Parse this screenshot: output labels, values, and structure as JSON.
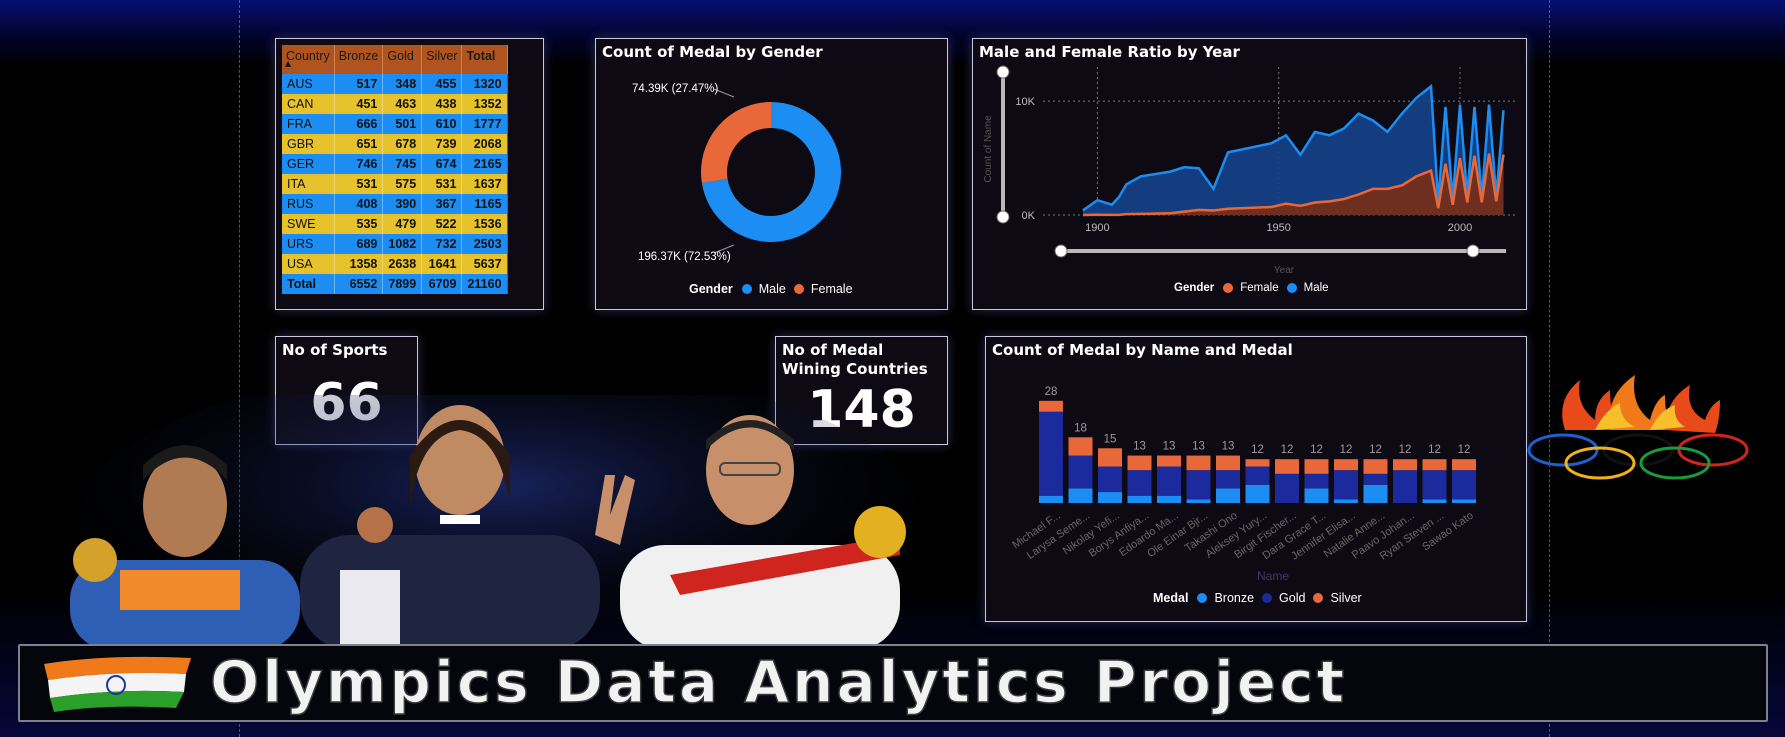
{
  "medal_table": {
    "headers": [
      "Country",
      "Bronze",
      "Gold",
      "Silver",
      "Total"
    ],
    "rows": [
      {
        "country": "AUS",
        "bronze": "517",
        "gold": "348",
        "silver": "455",
        "total": "1320"
      },
      {
        "country": "CAN",
        "bronze": "451",
        "gold": "463",
        "silver": "438",
        "total": "1352"
      },
      {
        "country": "FRA",
        "bronze": "666",
        "gold": "501",
        "silver": "610",
        "total": "1777"
      },
      {
        "country": "GBR",
        "bronze": "651",
        "gold": "678",
        "silver": "739",
        "total": "2068"
      },
      {
        "country": "GER",
        "bronze": "746",
        "gold": "745",
        "silver": "674",
        "total": "2165"
      },
      {
        "country": "ITA",
        "bronze": "531",
        "gold": "575",
        "silver": "531",
        "total": "1637"
      },
      {
        "country": "RUS",
        "bronze": "408",
        "gold": "390",
        "silver": "367",
        "total": "1165"
      },
      {
        "country": "SWE",
        "bronze": "535",
        "gold": "479",
        "silver": "522",
        "total": "1536"
      },
      {
        "country": "URS",
        "bronze": "689",
        "gold": "1082",
        "silver": "732",
        "total": "2503"
      },
      {
        "country": "USA",
        "bronze": "1358",
        "gold": "2638",
        "silver": "1641",
        "total": "5637"
      }
    ],
    "total": {
      "country": "Total",
      "bronze": "6552",
      "gold": "7899",
      "silver": "6709",
      "total": "21160"
    }
  },
  "gender_card": {
    "title": "Count of Medal by Gender",
    "female_label": "74.39K (27.47%)",
    "male_label": "196.37K (72.53%)",
    "legend_title": "Gender",
    "legend": [
      "Male",
      "Female"
    ]
  },
  "ratio_card": {
    "title": "Male and Female Ratio by Year",
    "legend_title": "Gender",
    "legend": [
      "Female",
      "Male"
    ]
  },
  "sports_card": {
    "title": "No of Sports",
    "value": "66"
  },
  "countries_card": {
    "title": "No of Medal Wining Countries",
    "value": "148"
  },
  "athlete_card": {
    "title": "Count of Medal by Name and Medal",
    "legend_title": "Medal",
    "legend": [
      "Bronze",
      "Gold",
      "Silver"
    ]
  },
  "banner": {
    "title": "Olympics Data Analytics Project"
  },
  "colors": {
    "male": "#1c8df2",
    "female": "#e8683a",
    "bronze": "#1c8df2",
    "gold": "#1b2a9c",
    "silver": "#e8683a",
    "row_blue": "#1c8df2",
    "row_yellow": "#e6c22c",
    "header": "#b0541f"
  },
  "chart_data": [
    {
      "type": "pie",
      "title": "Count of Medal by Gender",
      "categories": [
        "Male",
        "Female"
      ],
      "values": [
        196370,
        74390
      ],
      "labels": [
        "196.37K (72.53%)",
        "74.39K (27.47%)"
      ]
    },
    {
      "type": "area",
      "title": "Male and Female Ratio by Year",
      "xlabel": "Year",
      "ylabel": "Count of Name",
      "xlim": [
        1885,
        2016
      ],
      "ylim": [
        0,
        13000
      ],
      "x_ticks": [
        "1900",
        "1950",
        "2000"
      ],
      "y_ticks": [
        "0K",
        "10K"
      ],
      "series": [
        {
          "name": "Male",
          "x": [
            1896,
            1900,
            1904,
            1906,
            1908,
            1912,
            1920,
            1924,
            1928,
            1932,
            1936,
            1948,
            1952,
            1956,
            1960,
            1964,
            1968,
            1972,
            1976,
            1980,
            1984,
            1988,
            1992,
            1994,
            1996,
            1998,
            2000,
            2002,
            2004,
            2006,
            2008,
            2010,
            2012
          ],
          "values": [
            400,
            1300,
            900,
            1600,
            2700,
            3400,
            3800,
            4200,
            4100,
            2300,
            5500,
            6300,
            7000,
            5300,
            7300,
            7000,
            7600,
            8900,
            8300,
            7300,
            8900,
            10300,
            11300,
            1100,
            9500,
            1300,
            9700,
            1600,
            9500,
            1500,
            9700,
            1600,
            9200
          ]
        },
        {
          "name": "Female",
          "x": [
            1896,
            1900,
            1904,
            1906,
            1908,
            1912,
            1920,
            1924,
            1928,
            1932,
            1936,
            1948,
            1952,
            1956,
            1960,
            1964,
            1968,
            1972,
            1976,
            1980,
            1984,
            1988,
            1992,
            1994,
            1996,
            1998,
            2000,
            2002,
            2004,
            2006,
            2008,
            2010,
            2012
          ],
          "values": [
            0,
            20,
            10,
            10,
            80,
            100,
            150,
            300,
            450,
            400,
            550,
            700,
            1000,
            800,
            1100,
            1200,
            1400,
            1800,
            2300,
            2300,
            2600,
            3400,
            3900,
            600,
            4500,
            900,
            5000,
            1100,
            5200,
            1100,
            5400,
            1200,
            5300
          ]
        }
      ]
    },
    {
      "type": "bar",
      "title": "Count of Medal by Name and Medal",
      "xlabel": "Name",
      "categories": [
        "Michael F...",
        "Larysa Seme...",
        "Nikolay Yefi...",
        "Borys Anfiya...",
        "Edoardo Ma...",
        "Ole Einar Bjr...",
        "Takashi Ono",
        "Aleksey Yury...",
        "Birgit Fischer...",
        "Dara Grace T...",
        "Jennifer Elisa...",
        "Natalie Anne...",
        "Paavo Johan...",
        "Ryan Steven ...",
        "Sawao Kato"
      ],
      "totals": [
        28,
        18,
        15,
        13,
        13,
        13,
        13,
        12,
        12,
        12,
        12,
        12,
        12,
        12,
        12
      ],
      "series": [
        {
          "name": "Bronze",
          "values": [
            2,
            4,
            3,
            2,
            2,
            1,
            4,
            5,
            0,
            4,
            1,
            5,
            0,
            1,
            1
          ]
        },
        {
          "name": "Gold",
          "values": [
            23,
            9,
            7,
            7,
            8,
            8,
            5,
            5,
            8,
            4,
            8,
            3,
            9,
            8,
            8
          ]
        },
        {
          "name": "Silver",
          "values": [
            3,
            5,
            5,
            4,
            3,
            4,
            4,
            2,
            4,
            4,
            3,
            4,
            3,
            3,
            3
          ]
        }
      ]
    }
  ]
}
